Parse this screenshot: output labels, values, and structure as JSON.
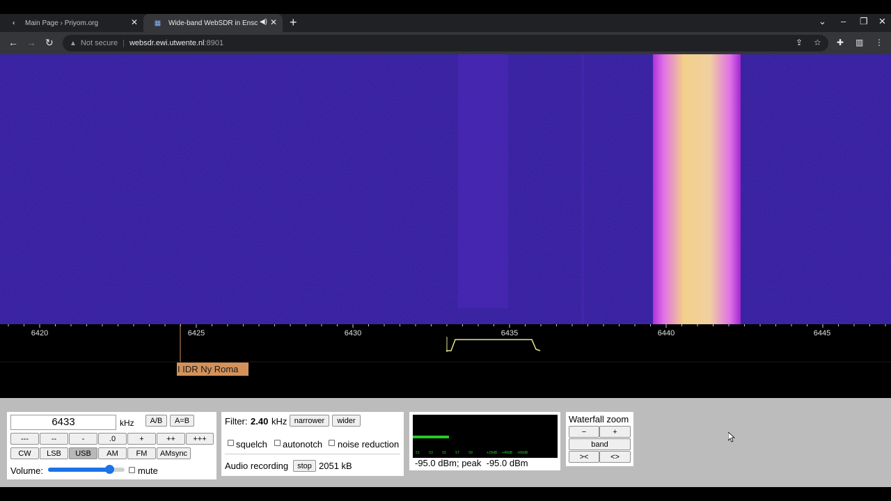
{
  "browser": {
    "tabs": [
      {
        "title": "Main Page › Priyom.org",
        "active": false
      },
      {
        "title": "Wide-band WebSDR in Ensch",
        "active": true
      }
    ],
    "security_label": "Not secure",
    "url_host": "websdr.ewi.utwente.nl",
    "url_port": ":8901"
  },
  "colors": {
    "waterfall_bg": "#2a1896",
    "signal_core": "#f3d08a",
    "signal_edge": "#c040e0",
    "passband": "#e8e890",
    "station_label_bg": "#d4925a",
    "smeter_bar": "#22cc22"
  },
  "scale": {
    "ticks": [
      "6420",
      "6425",
      "6430",
      "6435",
      "6440",
      "6445"
    ],
    "station_label": "I IDR Ny Roma"
  },
  "frequency": {
    "value": "6433",
    "unit": "kHz",
    "ab_label": "A/B",
    "aeqb_label": "A=B",
    "step_buttons": [
      "---",
      "--",
      "-",
      ".0",
      "+",
      "++",
      "+++"
    ],
    "mode_buttons": [
      "CW",
      "LSB",
      "USB",
      "AM",
      "FM",
      "AMsync"
    ],
    "selected_mode": "USB",
    "volume_label": "Volume:",
    "volume_level": 0.8,
    "mute_label": "mute"
  },
  "filter": {
    "label": "Filter:",
    "value": "2.40",
    "unit": "kHz",
    "narrower_label": "narrower",
    "wider_label": "wider",
    "squelch_label": "squelch",
    "autonotch_label": "autonotch",
    "noise_reduction_label": "noise reduction",
    "audio_recording_label": "Audio recording",
    "stop_label": "stop",
    "recording_size": "2051 kB"
  },
  "smeter": {
    "scale_labels": [
      "S1",
      "S3",
      "S5",
      "S7",
      "S9",
      "+20dB",
      "+40dB",
      "+60dB"
    ],
    "readout": "-95.0 dBm; peak  -95.0 dBm",
    "level_fraction": 0.25
  },
  "zoom": {
    "title": "Waterfall zoom",
    "minus_label": "−",
    "plus_label": "+",
    "band_label": "band",
    "narrow_label": "><",
    "widen_label": "<>"
  }
}
